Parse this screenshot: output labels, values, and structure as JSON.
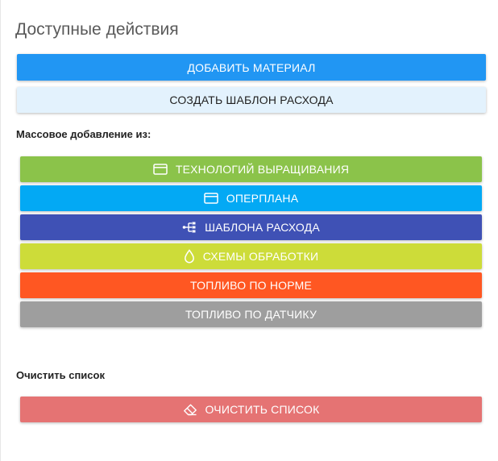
{
  "panel": {
    "title": "Доступные действия"
  },
  "primary_actions": {
    "add_material_label": "ДОБАВИТЬ МАТЕРИАЛ",
    "create_template_label": "СОЗДАТЬ ШАБЛОН РАСХОДА"
  },
  "mass_add": {
    "label": "Массовое добавление из:",
    "items": [
      {
        "label": "ТЕХНОЛОГИЙ ВЫРАЩИВАНИЯ",
        "icon": "card-icon",
        "color": "#8bc34a"
      },
      {
        "label": "ОПЕРПЛАНА",
        "icon": "card-icon",
        "color": "#03a9f4"
      },
      {
        "label": "ШАБЛОНА РАСХОДА",
        "icon": "hierarchy-icon",
        "color": "#3f51b5"
      },
      {
        "label": "СХЕМЫ ОБРАБОТКИ",
        "icon": "drop-icon",
        "color": "#cddc39"
      },
      {
        "label": "ТОПЛИВО ПО НОРМЕ",
        "icon": "",
        "color": "#ff5722"
      },
      {
        "label": "ТОПЛИВО ПО ДАТЧИКУ",
        "icon": "",
        "color": "#9e9e9e"
      }
    ]
  },
  "clear": {
    "section_label": "Очистить список",
    "button_label": "ОЧИСТИТЬ СПИСОК",
    "icon": "eraser-icon",
    "color": "#e57373"
  },
  "colors": {
    "primary": "#2196f3",
    "secondary_bg": "#e3f2fd"
  }
}
